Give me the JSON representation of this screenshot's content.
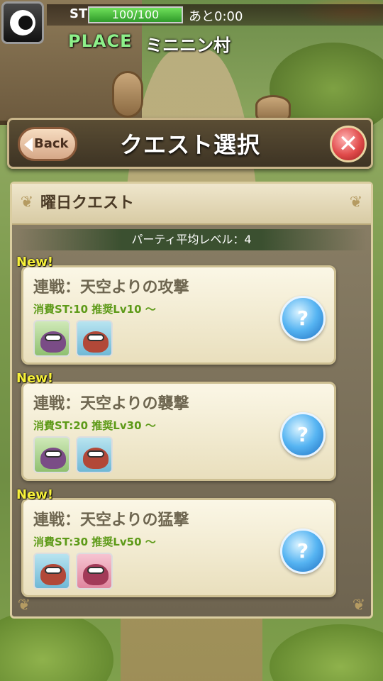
{
  "status": {
    "st_label": "ST",
    "st_value": "100/100",
    "st_fraction": 1.0,
    "time_text": "あと0:00",
    "place_label": "PLACE",
    "place_name": "ミニニン村"
  },
  "header": {
    "back_label": "Back",
    "title": "クエスト選択",
    "close_symbol": "✕"
  },
  "panel": {
    "title": "曜日クエスト",
    "party_level_text": "パーティ平均レベル：4"
  },
  "quests": [
    {
      "badge": "New!",
      "title": "連戦：天空よりの攻撃",
      "cost": "消費ST:10 推奨Lv10 〜",
      "monsters": [
        "green-monster-icon",
        "blue-monster-icon"
      ]
    },
    {
      "badge": "New!",
      "title": "連戦：天空よりの襲撃",
      "cost": "消費ST:20 推奨Lv30 〜",
      "monsters": [
        "green-monster-icon",
        "blue-monster-icon"
      ]
    },
    {
      "badge": "New!",
      "title": "連戦：天空よりの猛撃",
      "cost": "消費ST:30 推奨Lv50 〜",
      "monsters": [
        "blue-monster-icon",
        "pink-monster-icon"
      ]
    }
  ],
  "icons": {
    "info": "?",
    "menu": "menu-emblem-icon"
  },
  "colors": {
    "st_fill": "#4bc43a",
    "place_label": "#8ef08a",
    "cost_text": "#5d9a18",
    "new_badge": "#f6f03a",
    "close": "#e04a4a",
    "info": "#56b4f2"
  }
}
